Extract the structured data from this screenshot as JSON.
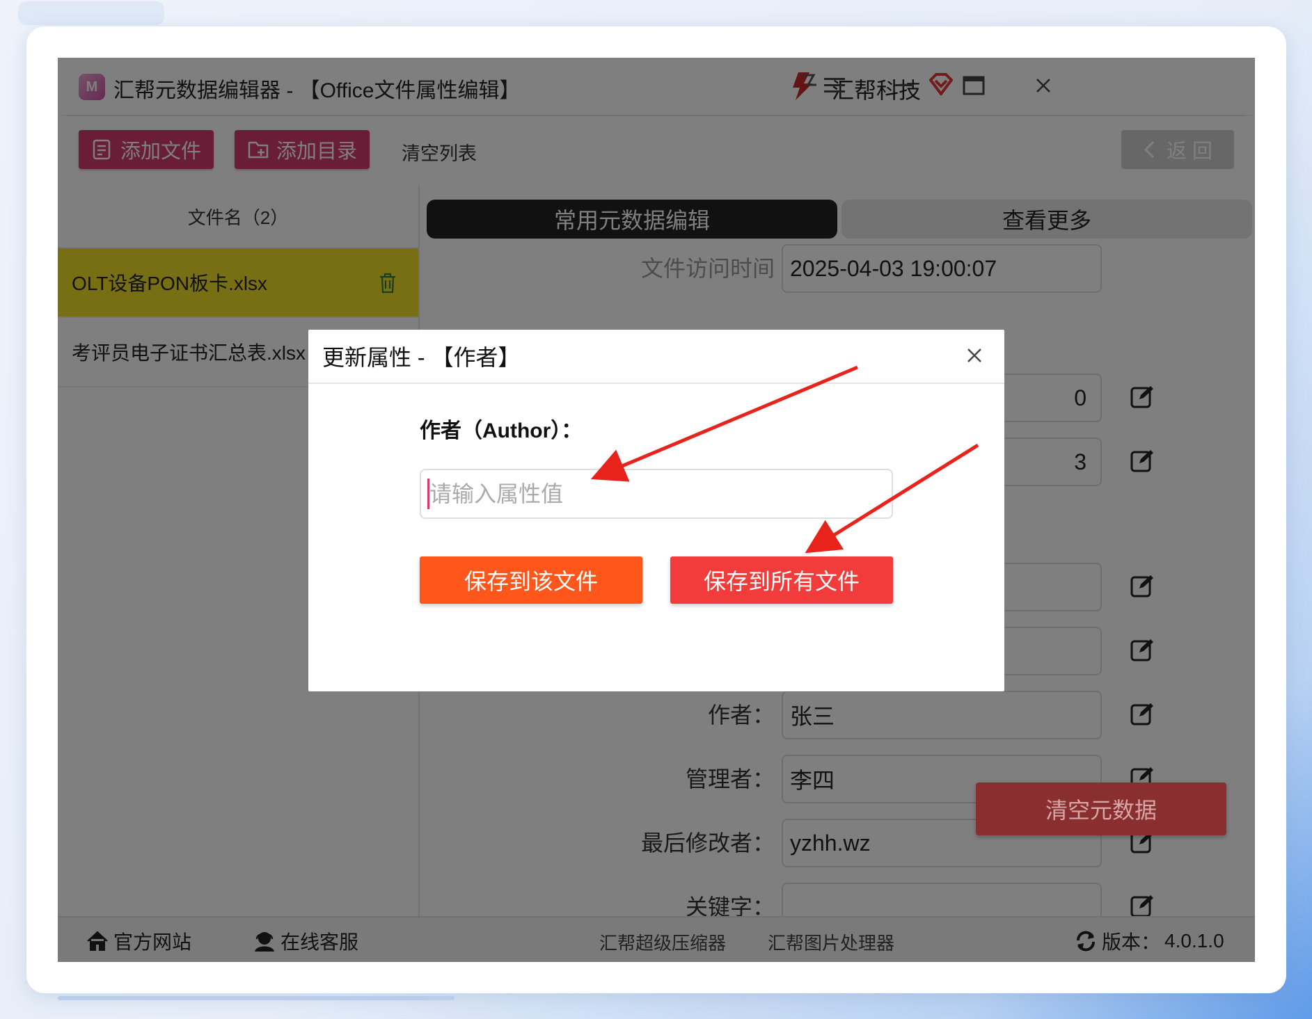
{
  "window": {
    "title": "汇帮元数据编辑器 - 【Office文件属性编辑】",
    "brand": "汇帮科技"
  },
  "toolbar": {
    "add_file": "添加文件",
    "add_dir": "添加目录",
    "clear_list": "清空列表",
    "back": "返 回"
  },
  "file_list": {
    "header": "文件名（2）",
    "items": [
      {
        "name": "OLT设备PON板卡.xlsx"
      },
      {
        "name": "考评员电子证书汇总表.xlsx"
      }
    ]
  },
  "tabs": {
    "common": "常用元数据编辑",
    "more": "查看更多"
  },
  "fields": {
    "access_time_label": "文件访问时间",
    "access_time_value": "2025-04-03 19:00:07",
    "hidden_value_1": "0",
    "hidden_value_2": "3",
    "author_label": "作者：",
    "author_value": "张三",
    "manager_label": "管理者：",
    "manager_value": "李四",
    "last_modified_label": "最后修改者：",
    "last_modified_value": "yzhh.wz",
    "keywords_label": "关键字：",
    "keywords_value": ""
  },
  "clear_metadata": "清空元数据",
  "footer": {
    "website": "官方网站",
    "support": "在线客服",
    "compressor": "汇帮超级压缩器",
    "image_tool": "汇帮图片处理器",
    "version_label": "版本：",
    "version_value": "4.0.1.0"
  },
  "dialog": {
    "title": "更新属性 - 【作者】",
    "field_label": "作者（Author）：",
    "placeholder": "请输入属性值",
    "save_one": "保存到该文件",
    "save_all": "保存到所有文件"
  },
  "colors": {
    "accent": "#d43a6d",
    "selected_row": "#f0de2b",
    "save_one": "#fe561b",
    "save_all": "#f23c3c",
    "annotation_arrow": "#e8231c"
  },
  "icons": [
    "app-logo-icon",
    "brand-icon",
    "vip-icon",
    "menu-icon",
    "minimize-icon",
    "maximize-icon",
    "close-icon",
    "add-file-icon",
    "add-folder-icon",
    "chevron-left-icon",
    "trash-icon",
    "edit-icon",
    "home-icon",
    "support-icon",
    "refresh-icon"
  ]
}
